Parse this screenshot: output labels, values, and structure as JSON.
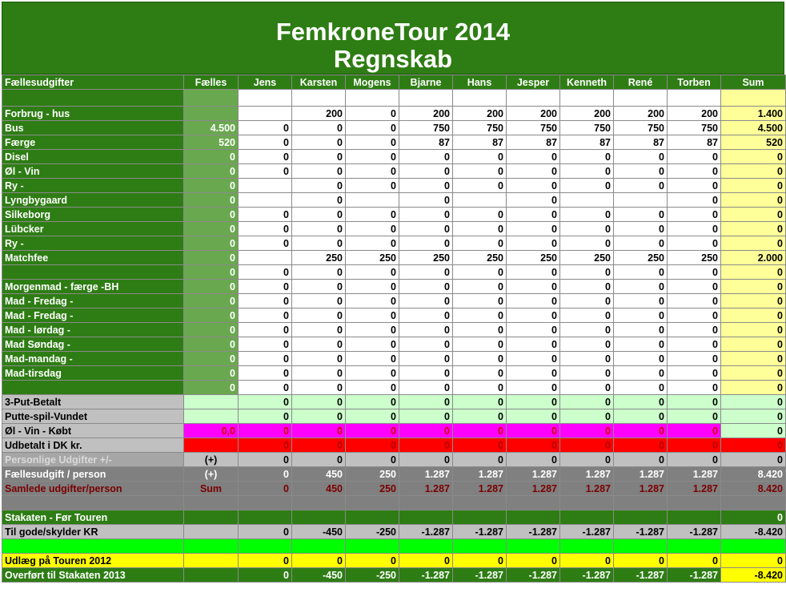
{
  "title": {
    "line1": "FemkroneTour 2014",
    "line2": "Regnskab"
  },
  "header": [
    "Fællesudgifter",
    "Fælles",
    "Jens",
    "Karsten",
    "Mogens",
    "Bjarne",
    "Hans",
    "Jesper",
    "Kenneth",
    "René",
    "Torben",
    "Sum"
  ],
  "expense_rows": [
    {
      "label": "",
      "faelles": "",
      "vals": [
        "",
        "",
        "",
        "",
        "",
        "",
        "",
        "",
        ""
      ],
      "sum": ""
    },
    {
      "label": "Forbrug - hus",
      "faelles": "",
      "vals": [
        "",
        "200",
        "0",
        "200",
        "200",
        "200",
        "200",
        "200",
        "200"
      ],
      "sum": "1.400"
    },
    {
      "label": "Bus",
      "faelles": "4.500",
      "vals": [
        "0",
        "0",
        "0",
        "750",
        "750",
        "750",
        "750",
        "750",
        "750"
      ],
      "sum": "4.500"
    },
    {
      "label": "Færge",
      "faelles": "520",
      "vals": [
        "0",
        "0",
        "0",
        "87",
        "87",
        "87",
        "87",
        "87",
        "87"
      ],
      "sum": "520"
    },
    {
      "label": "Disel",
      "faelles": "0",
      "vals": [
        "0",
        "0",
        "0",
        "0",
        "0",
        "0",
        "0",
        "0",
        "0"
      ],
      "sum": "0"
    },
    {
      "label": "Øl - Vin",
      "faelles": "0",
      "vals": [
        "0",
        "0",
        "0",
        "0",
        "0",
        "0",
        "0",
        "0",
        "0"
      ],
      "sum": "0"
    },
    {
      "label": "Ry -",
      "faelles": "0",
      "vals": [
        "",
        "0",
        "0",
        "0",
        "0",
        "0",
        "0",
        "0",
        "0"
      ],
      "sum": "0"
    },
    {
      "label": "Lyngbygaard",
      "faelles": "0",
      "vals": [
        "",
        "0",
        "",
        "0",
        "",
        "0",
        "",
        "",
        "0"
      ],
      "sum": "0"
    },
    {
      "label": "Silkeborg",
      "faelles": "0",
      "vals": [
        "0",
        "0",
        "0",
        "0",
        "0",
        "0",
        "0",
        "0",
        "0"
      ],
      "sum": "0"
    },
    {
      "label": "Lübcker",
      "faelles": "0",
      "vals": [
        "0",
        "0",
        "0",
        "0",
        "0",
        "0",
        "0",
        "0",
        "0"
      ],
      "sum": "0"
    },
    {
      "label": "Ry -",
      "faelles": "0",
      "vals": [
        "0",
        "0",
        "0",
        "0",
        "0",
        "0",
        "0",
        "0",
        "0"
      ],
      "sum": "0"
    },
    {
      "label": "Matchfee",
      "faelles": "0",
      "vals": [
        "",
        "250",
        "250",
        "250",
        "250",
        "250",
        "250",
        "250",
        "250"
      ],
      "sum": "2.000"
    },
    {
      "label": "",
      "faelles": "0",
      "vals": [
        "0",
        "0",
        "0",
        "0",
        "0",
        "0",
        "0",
        "0",
        "0"
      ],
      "sum": "0"
    },
    {
      "label": "Morgenmad - færge -BH",
      "faelles": "0",
      "vals": [
        "0",
        "0",
        "0",
        "0",
        "0",
        "0",
        "0",
        "0",
        "0"
      ],
      "sum": "0"
    },
    {
      "label": "Mad - Fredag -",
      "faelles": "0",
      "vals": [
        "0",
        "0",
        "0",
        "0",
        "0",
        "0",
        "0",
        "0",
        "0"
      ],
      "sum": "0"
    },
    {
      "label": "Mad - Fredag -",
      "faelles": "0",
      "vals": [
        "0",
        "0",
        "0",
        "0",
        "0",
        "0",
        "0",
        "0",
        "0"
      ],
      "sum": "0"
    },
    {
      "label": "Mad - lørdag -",
      "faelles": "0",
      "vals": [
        "0",
        "0",
        "0",
        "0",
        "0",
        "0",
        "0",
        "0",
        "0"
      ],
      "sum": "0"
    },
    {
      "label": "Mad Søndag -",
      "faelles": "0",
      "vals": [
        "0",
        "0",
        "0",
        "0",
        "0",
        "0",
        "0",
        "0",
        "0"
      ],
      "sum": "0"
    },
    {
      "label": "Mad-mandag -",
      "faelles": "0",
      "vals": [
        "0",
        "0",
        "0",
        "0",
        "0",
        "0",
        "0",
        "0",
        "0"
      ],
      "sum": "0"
    },
    {
      "label": "Mad-tirsdag",
      "faelles": "0",
      "vals": [
        "0",
        "0",
        "0",
        "0",
        "0",
        "0",
        "0",
        "0",
        "0"
      ],
      "sum": "0"
    },
    {
      "label": "",
      "faelles": "0",
      "vals": [
        "0",
        "0",
        "0",
        "0",
        "0",
        "0",
        "0",
        "0",
        "0"
      ],
      "sum": "0"
    }
  ],
  "summary": {
    "put_betalt": {
      "label": "3-Put-Betalt",
      "faelles": "",
      "vals": [
        "0",
        "0",
        "0",
        "0",
        "0",
        "0",
        "0",
        "0",
        "0"
      ],
      "sum": "0"
    },
    "putte_vundet": {
      "label": "Putte-spil-Vundet",
      "faelles": "",
      "vals": [
        "0",
        "0",
        "0",
        "0",
        "0",
        "0",
        "0",
        "0",
        "0"
      ],
      "sum": "0"
    },
    "ol_kobt": {
      "label": "Øl - Vin - Købt",
      "faelles": "0,0",
      "vals": [
        "0",
        "0",
        "0",
        "0",
        "0",
        "0",
        "0",
        "0",
        "0"
      ],
      "sum": "0"
    },
    "udbetalt": {
      "label": "Udbetalt i DK kr.",
      "faelles": "",
      "vals": [
        "0",
        "0",
        "0",
        "0",
        "0",
        "0",
        "0",
        "0",
        "0"
      ],
      "sum": "0"
    },
    "personlige": {
      "label": "Personlige Udgifter +/-",
      "faelles": "(+)",
      "vals": [
        "0",
        "0",
        "0",
        "0",
        "0",
        "0",
        "0",
        "0",
        "0"
      ],
      "sum": "0"
    },
    "faellesudgift": {
      "label": "Fællesudgift / person",
      "faelles": "(+)",
      "vals": [
        "0",
        "450",
        "250",
        "1.287",
        "1.287",
        "1.287",
        "1.287",
        "1.287",
        "1.287"
      ],
      "sum": "8.420"
    },
    "samlede": {
      "label": "Samlede udgifter/person",
      "faelles": "Sum",
      "vals": [
        "0",
        "450",
        "250",
        "1.287",
        "1.287",
        "1.287",
        "1.287",
        "1.287",
        "1.287"
      ],
      "sum": "8.420"
    },
    "stakaten": {
      "label": "Stakaten - Før Touren",
      "sum": "0"
    },
    "til_gode": {
      "label": "Til gode/skylder KR",
      "vals": [
        "0",
        "-450",
        "-250",
        "-1.287",
        "-1.287",
        "-1.287",
        "-1.287",
        "-1.287",
        "-1.287"
      ],
      "sum": "-8.420"
    },
    "udlaeg": {
      "label": "Udlæg på Touren 2012",
      "vals": [
        "0",
        "0",
        "0",
        "0",
        "0",
        "0",
        "0",
        "0",
        "0"
      ],
      "sum": "0"
    },
    "overfoert": {
      "label": "Overført til Stakaten 2013",
      "vals": [
        "0",
        "-450",
        "-250",
        "-1.287",
        "-1.287",
        "-1.287",
        "-1.287",
        "-1.287",
        "-1.287"
      ],
      "sum": "-8.420"
    }
  }
}
